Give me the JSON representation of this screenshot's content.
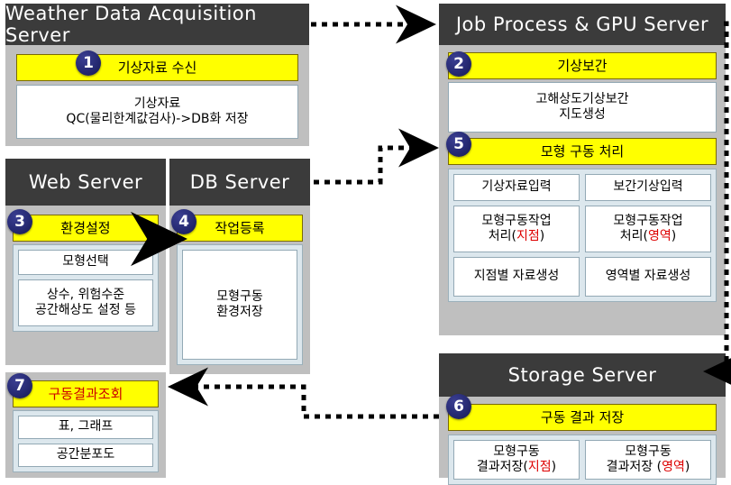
{
  "diagram": {
    "title": "Weather model processing system architecture",
    "colors": {
      "header_bg": "#3B3B3B",
      "panel_bg": "#BFBFBF",
      "accent_yellow": "#FFFF00",
      "inner_bg": "#DCE7ED",
      "badge_blue": "#262A73",
      "highlight_red": "#CC0000"
    }
  },
  "servers": {
    "weather": {
      "title": "Weather Data Acquisition Server",
      "badge": "1",
      "yellow_label": "기상자료 수신",
      "detail_line1": "기상자료",
      "detail_line2": "QC(물리한계값검사)->DB화 저장"
    },
    "job": {
      "title": "Job Process & GPU Server",
      "badge_interp": "2",
      "interp_label": "기상보간",
      "interp_detail_line1": "고해상도기상보간",
      "interp_detail_line2": "지도생성",
      "badge_model": "5",
      "model_label": "모형 구동 처리",
      "left_col": [
        {
          "text": "기상자료입력"
        },
        {
          "text_line1": "모형구동작업",
          "text_line2_prefix": "처리(",
          "text_line2_red": "지점",
          "text_line2_suffix": ")"
        },
        {
          "text": "지점별 자료생성"
        }
      ],
      "right_col": [
        {
          "text": "보간기상입력"
        },
        {
          "text_line1": "모형구동작업",
          "text_line2_prefix": "처리(",
          "text_line2_red": "영역",
          "text_line2_suffix": ")"
        },
        {
          "text": "영역별 자료생성"
        }
      ]
    },
    "web": {
      "title": "Web Server",
      "badge": "3",
      "yellow_label": "환경설정",
      "items": [
        "모형선택",
        "상수, 위험수준\n공간해상도 설정 등"
      ]
    },
    "db": {
      "title": "DB Server",
      "badge": "4",
      "yellow_label": "작업등록",
      "item_line1": "모형구동",
      "item_line2": "환경저장"
    },
    "result": {
      "badge": "7",
      "yellow_label": "구동결과조회",
      "items": [
        "표, 그래프",
        "공간분포도"
      ]
    },
    "storage": {
      "title": "Storage Server",
      "badge": "6",
      "yellow_label": "구동 결과 저장",
      "left_line1": "모형구동",
      "left_line2_prefix": "결과저장(",
      "left_line2_red": "지점",
      "left_line2_suffix": ")",
      "right_line1": "모형구동",
      "right_line2_prefix": "결과저장 (",
      "right_line2_red": "영역",
      "right_line2_suffix": ")"
    }
  }
}
